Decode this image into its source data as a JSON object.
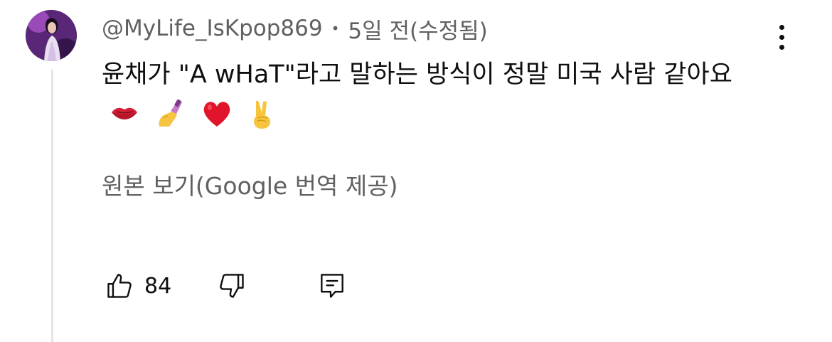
{
  "comment": {
    "author": "@MyLife_IsKpop869",
    "separator": "•",
    "time": "5일 전(수정됨)",
    "text": "윤채가 \"A wHaT\"라고 말하는 방식이 정말 미국 사람 같아요",
    "emojis": [
      "kiss-mark-icon",
      "nail-polish-icon",
      "red-heart-icon",
      "victory-hand-icon"
    ],
    "translate_link": "원본 보기(Google 번역 제공)",
    "like_count": "84"
  },
  "icons": {
    "avatar": "avatar",
    "more": "more-vertical-icon",
    "like": "thumbs-up-icon",
    "dislike": "thumbs-down-icon",
    "reply": "reply-comment-icon"
  },
  "colors": {
    "secondary_text": "#606060",
    "primary_text": "#0f0f0f",
    "thread_line": "#e5e5e5"
  }
}
